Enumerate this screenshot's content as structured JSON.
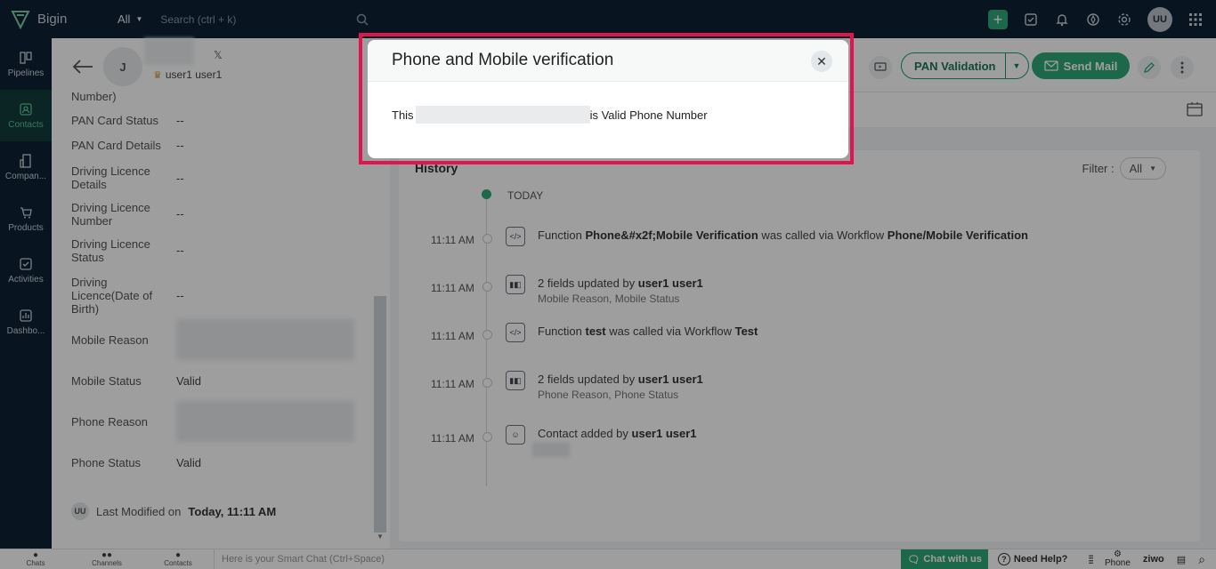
{
  "topbar": {
    "app_name": "Bigin",
    "scope": "All",
    "search_placeholder": "Search (ctrl + k)",
    "user_initials": "UU"
  },
  "sidebar": {
    "items": [
      {
        "label": "Pipelines",
        "icon": "pipelines-icon"
      },
      {
        "label": "Contacts",
        "icon": "contacts-icon",
        "active": true
      },
      {
        "label": "Compan...",
        "icon": "companies-icon"
      },
      {
        "label": "Products",
        "icon": "products-icon"
      },
      {
        "label": "Activities",
        "icon": "activities-icon"
      },
      {
        "label": "Dashbo...",
        "icon": "dashboards-icon"
      }
    ]
  },
  "contact": {
    "avatar_initial": "J",
    "owner": "user1 user1"
  },
  "fields": [
    {
      "label": "Number)",
      "value": ""
    },
    {
      "label": "PAN Card Status",
      "value": "--"
    },
    {
      "label": "PAN Card Details",
      "value": "--"
    },
    {
      "label": "Driving Licence Details",
      "value": "--"
    },
    {
      "label": "Driving Licence Number",
      "value": "--"
    },
    {
      "label": "Driving Licence Status",
      "value": "--"
    },
    {
      "label": "Driving Licence(Date of Birth)",
      "value": "--"
    },
    {
      "label": "Mobile Reason",
      "value": ""
    },
    {
      "label": "Mobile Status",
      "value": "Valid"
    },
    {
      "label": "Phone Reason",
      "value": ""
    },
    {
      "label": "Phone Status",
      "value": "Valid"
    }
  ],
  "modified": {
    "initials": "UU",
    "label": "Last Modified on",
    "when": "Today, 11:11 AM"
  },
  "actions": {
    "pan_validation": "PAN Validation",
    "send_mail": "Send Mail"
  },
  "history": {
    "title": "History",
    "filter_label": "Filter :",
    "filter_value": "All",
    "today": "TODAY",
    "events": [
      {
        "time": "11:11 AM",
        "icon": "function-icon",
        "pre": "Function ",
        "b1": "Phone&#x2f;Mobile Verification",
        "mid": " was called via Workflow ",
        "b2": "Phone/Mobile Verification",
        "sub": ""
      },
      {
        "time": "11:11 AM",
        "icon": "field-update-icon",
        "pre": "2 fields updated by ",
        "b1": "user1 user1",
        "mid": "",
        "b2": "",
        "sub": "Mobile Reason, Mobile Status"
      },
      {
        "time": "11:11 AM",
        "icon": "function-icon",
        "pre": "Function ",
        "b1": "test",
        "mid": " was called via Workflow ",
        "b2": "Test",
        "sub": ""
      },
      {
        "time": "11:11 AM",
        "icon": "field-update-icon",
        "pre": "2 fields updated by ",
        "b1": "user1 user1",
        "mid": "",
        "b2": "",
        "sub": "Phone Reason, Phone Status"
      },
      {
        "time": "11:11 AM",
        "icon": "contact-added-icon",
        "pre": "Contact added by ",
        "b1": "user1 user1",
        "mid": "",
        "b2": "",
        "sub": ""
      }
    ]
  },
  "footer": {
    "chats": "Chats",
    "channels": "Channels",
    "contacts": "Contacts",
    "smart_chat_placeholder": "Here is your Smart Chat (Ctrl+Space)",
    "chat_with_us": "Chat with us",
    "need_help": "Need Help?",
    "phone": "Phone",
    "brand": "ziwo"
  },
  "modal": {
    "title": "Phone and Mobile verification",
    "message_prefix": "This",
    "message_suffix": "is Valid Phone Number",
    "highlight_color": "#e0154f"
  }
}
